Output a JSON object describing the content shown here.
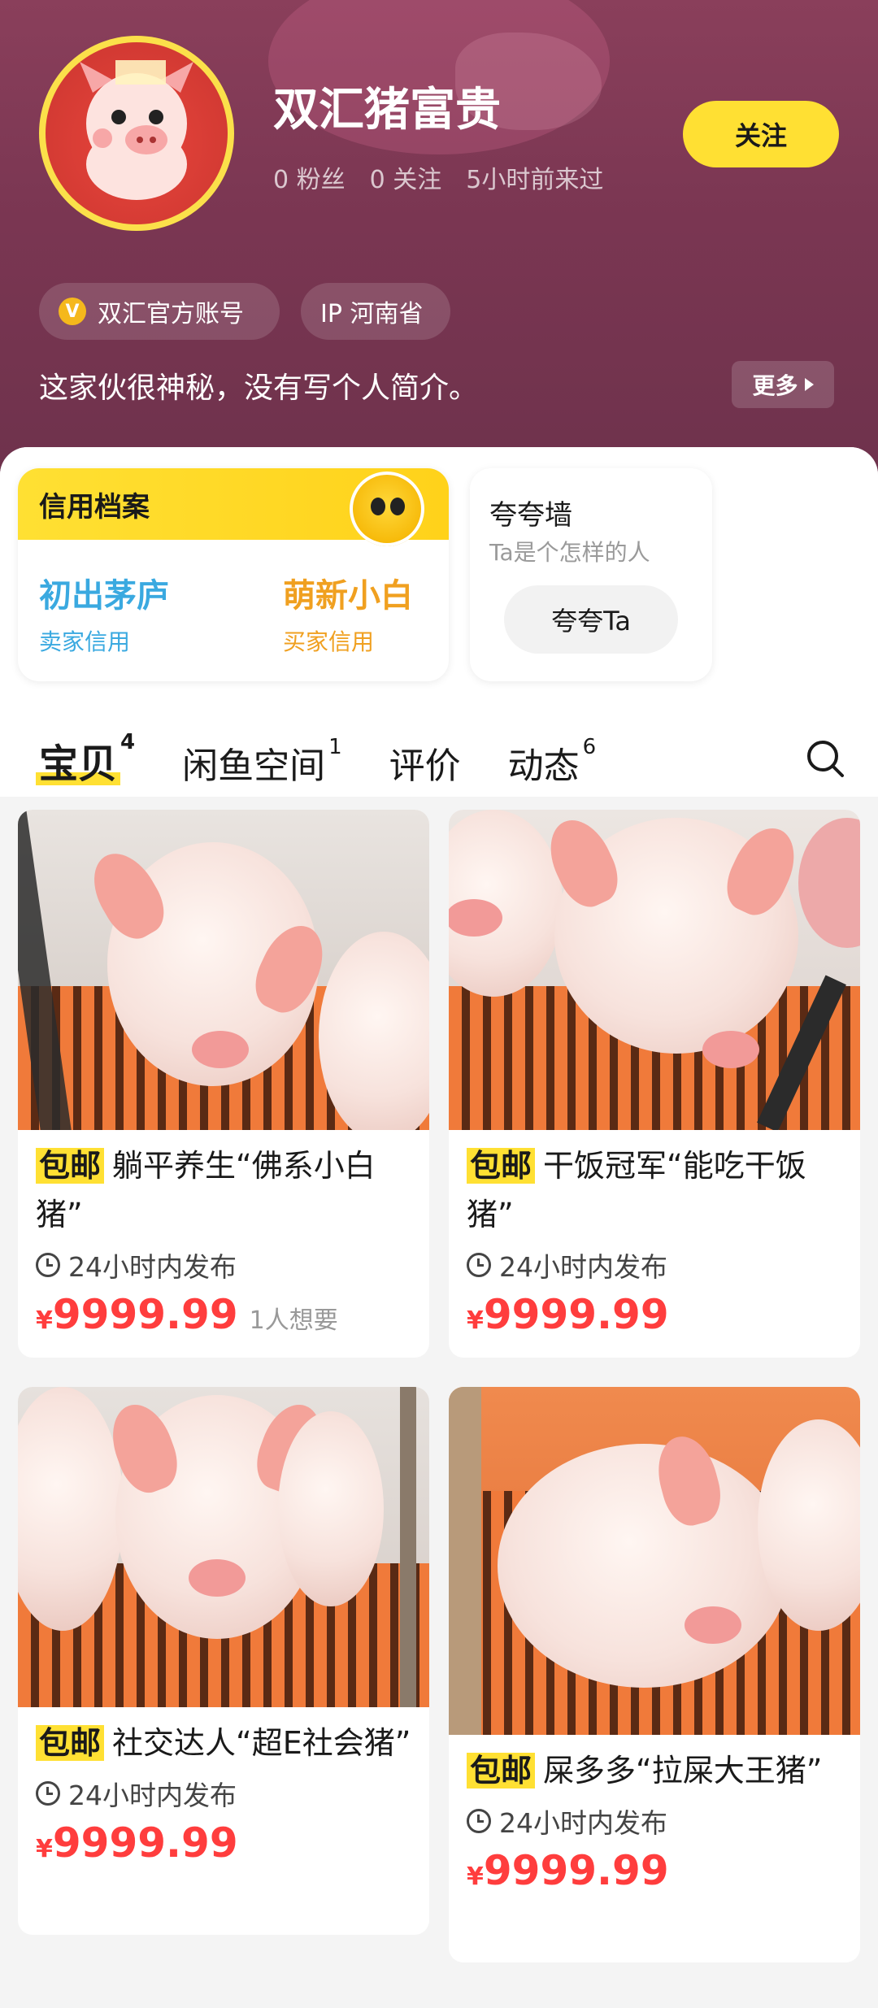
{
  "profile": {
    "name": "双汇猪富贵",
    "stats": [
      "0 粉丝",
      "0 关注",
      "5小时前来过"
    ],
    "follow_label": "关注",
    "tags": {
      "official": "双汇官方账号",
      "official_icon": "V",
      "ip": "IP 河南省"
    },
    "bio": "这家伙很神秘，没有写个人简介。",
    "more_label": "更多"
  },
  "credit": {
    "title": "信用档案",
    "seller_value": "初出茅庐",
    "seller_label": "卖家信用",
    "buyer_value": "萌新小白",
    "buyer_label": "买家信用"
  },
  "praise": {
    "title": "夸夸墙",
    "subtitle": "Ta是个怎样的人",
    "button": "夸夸Ta"
  },
  "tabs": [
    {
      "label": "宝贝",
      "count": "4"
    },
    {
      "label": "闲鱼空间",
      "count": "1"
    },
    {
      "label": "评价",
      "count": ""
    },
    {
      "label": "动态",
      "count": "6"
    }
  ],
  "products": [
    {
      "badge": "包邮",
      "title": "躺平养生“佛系小白猪”",
      "time": "24小时内发布",
      "currency": "¥",
      "price": "9999.99",
      "want": "1人想要"
    },
    {
      "badge": "包邮",
      "title": "干饭冠军“能吃干饭猪”",
      "time": "24小时内发布",
      "currency": "¥",
      "price": "9999.99",
      "want": ""
    },
    {
      "badge": "包邮",
      "title": "社交达人“超E社会猪”",
      "time": "24小时内发布",
      "currency": "¥",
      "price": "9999.99",
      "want": ""
    },
    {
      "badge": "包邮",
      "title": "屎多多“拉屎大王猪”",
      "time": "24小时内发布",
      "currency": "¥",
      "price": "9999.99",
      "want": ""
    }
  ],
  "colors": {
    "header": "#7a3652",
    "accent": "#ffe033",
    "price": "#ff3d3d",
    "seller_credit": "#3aa9e0",
    "buyer_credit": "#f0a020"
  }
}
